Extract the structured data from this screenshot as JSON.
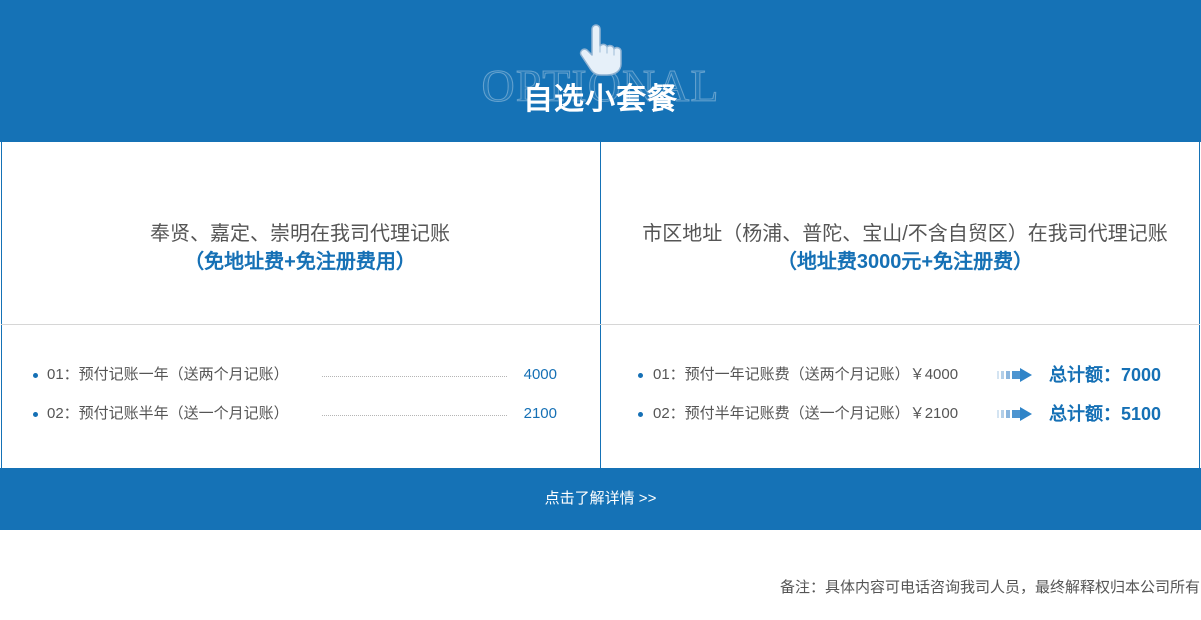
{
  "theme": {
    "primary": "#1572b6",
    "accent": "#1570b5",
    "text": "#555555"
  },
  "header": {
    "watermark": "OPTIONAL",
    "title": "自选小套餐",
    "icon": "hand-pointer-icon"
  },
  "packages": [
    {
      "description": "奉贤、嘉定、崇明在我司代理记账",
      "highlight": "（免地址费+免注册费用）",
      "items": [
        {
          "label": "01：预付记账一年（送两个月记账）",
          "price": "4000"
        },
        {
          "label": "02：预付记账半年（送一个月记账）",
          "price": "2100"
        }
      ]
    },
    {
      "description": "市区地址（杨浦、普陀、宝山/不含自贸区）在我司代理记账",
      "highlight": "（地址费3000元+免注册费）",
      "items": [
        {
          "label": "01：预付一年记账费（送两个月记账）",
          "price": "￥4000",
          "arrow_icon": "arrow-right-icon",
          "total_label": "总计额：",
          "total": "7000"
        },
        {
          "label": "02：预付半年记账费（送一个月记账）",
          "price": "￥2100",
          "arrow_icon": "arrow-right-icon",
          "total_label": "总计额：",
          "total": "5100"
        }
      ]
    }
  ],
  "cta": {
    "label": "点击了解详情 >>"
  },
  "footer": {
    "note": "备注：具体内容可电话咨询我司人员，最终解释权归本公司所有"
  }
}
